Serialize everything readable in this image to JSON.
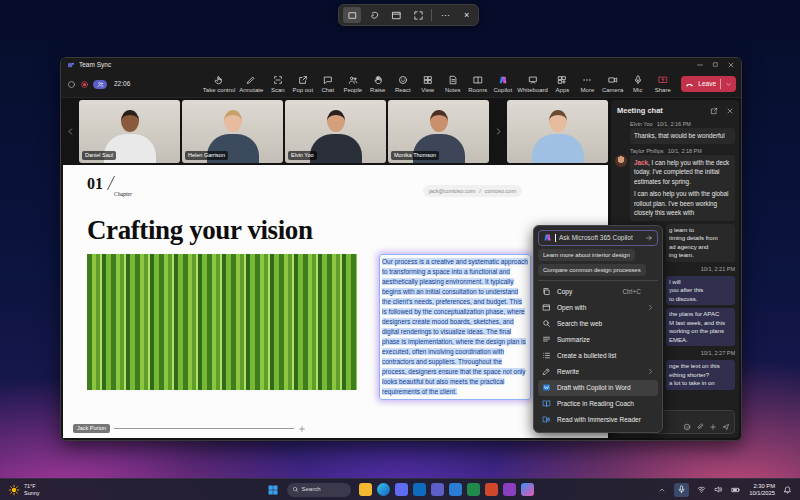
{
  "snip_toolbar": {
    "modes": [
      {
        "kind": "rectangle",
        "selected": true
      },
      {
        "kind": "freeform",
        "selected": false
      },
      {
        "kind": "window",
        "selected": false
      },
      {
        "kind": "fullscreen",
        "selected": false
      }
    ],
    "more": "···",
    "close": "×"
  },
  "window": {
    "title": "Team Sync",
    "timer": "22:06"
  },
  "toolbar": {
    "items": [
      {
        "label": "Take control",
        "kind": "control",
        "active": false
      },
      {
        "label": "Annotate",
        "kind": "annotate",
        "active": false
      },
      {
        "label": "Scan",
        "kind": "scan",
        "active": false
      },
      {
        "label": "Pop out",
        "kind": "popout",
        "active": false
      },
      {
        "label": "Chat",
        "kind": "chat",
        "active": false
      },
      {
        "label": "People",
        "kind": "people",
        "active": false
      },
      {
        "label": "Raise",
        "kind": "raise",
        "active": false
      },
      {
        "label": "React",
        "kind": "react",
        "active": false
      },
      {
        "label": "View",
        "kind": "view",
        "active": false
      },
      {
        "label": "Notes",
        "kind": "notes",
        "active": false
      },
      {
        "label": "Rooms",
        "kind": "rooms",
        "active": false
      },
      {
        "label": "Copilot",
        "kind": "copilot",
        "active": false
      },
      {
        "label": "Whiteboard",
        "kind": "whiteboard",
        "active": false
      },
      {
        "label": "Apps",
        "kind": "apps",
        "active": false
      },
      {
        "label": "More",
        "kind": "more",
        "active": false
      },
      {
        "label": "Camera",
        "kind": "camera",
        "active": false
      },
      {
        "label": "Mic",
        "kind": "mic",
        "active": false
      },
      {
        "label": "Share",
        "kind": "share",
        "active": true
      }
    ],
    "leave": "Leave"
  },
  "participants": [
    {
      "kind": "named",
      "name": "Daniel Saul"
    },
    {
      "kind": "named",
      "name": "Helen Garrison"
    },
    {
      "kind": "named",
      "name": "Elvin Yoo"
    },
    {
      "kind": "named",
      "name": "Monika Thomson"
    },
    {
      "kind": "unnamed"
    }
  ],
  "slide": {
    "number": "01",
    "section": "Chapter",
    "email": "jack@contoso.com",
    "separator": "/",
    "site": "contoso.com",
    "title": "Crafting your vision",
    "body": "Our process is a creative and systematic approach to transforming a space into a functional and aesthetically pleasing environment. It typically begins with an initial consultation to understand the client's needs, preferences, and budget. This is followed by the conceptualization phase, where designers create mood boards, sketches, and digital renderings to visualize ideas. The final phase is implementation, where the design plan is executed, often involving coordination with contractors and suppliers. Throughout the process, designers ensure that the space not only looks beautiful but also meets the practical requirements of the client.",
    "body_selected": true,
    "presenter": "Jack Purton"
  },
  "context_menu": {
    "prompt_placeholder": "Ask Microsoft 365 Copilot",
    "suggestions": [
      "Learn more about interior design",
      "Compare common design processes"
    ],
    "items": [
      {
        "label": "Copy",
        "kind": "copy",
        "shortcut": "Ctrl+C",
        "submenu": false,
        "highlighted": false
      },
      {
        "label": "Open with",
        "kind": "open",
        "submenu": true,
        "highlighted": false
      },
      {
        "label": "Search the web",
        "kind": "search",
        "submenu": false,
        "highlighted": false
      },
      {
        "label": "Summarize",
        "kind": "summarize",
        "submenu": false,
        "highlighted": false
      },
      {
        "label": "Create a bulleted list",
        "kind": "list",
        "submenu": false,
        "highlighted": false
      },
      {
        "label": "Rewrite",
        "kind": "rewrite",
        "submenu": true,
        "highlighted": false
      },
      {
        "label": "Draft with Copilot in Word",
        "kind": "word",
        "submenu": false,
        "highlighted": true
      },
      {
        "label": "Practice in Reading Coach",
        "kind": "reading",
        "submenu": false,
        "highlighted": false
      },
      {
        "label": "Read with Immersive Reader",
        "kind": "immersive",
        "submenu": false,
        "highlighted": false
      }
    ]
  },
  "chat": {
    "title": "Meeting chat",
    "messages": [
      {
        "kind": "received",
        "author": "Elvin Yoo",
        "time": "10/1, 2:16 PM",
        "avatar": false,
        "paragraphs": [
          {
            "text": "Thanks, that would be wonderful"
          }
        ]
      },
      {
        "kind": "received",
        "author": "Taylor Phillips",
        "time": "10/1, 2:18 PM",
        "avatar": true,
        "paragraphs": [
          {
            "mention": "Jack",
            "text": ", I can help you with the deck today. I've completed the initial estimates for spring."
          },
          {
            "text": "I can also help you with the global rollout plan. I've been working closely this week with"
          }
        ]
      },
      {
        "kind": "clipped",
        "lines": [
          "g team to",
          "timing details from",
          "ad agency and",
          "ing team."
        ]
      },
      {
        "kind": "timestamp",
        "time": "10/1, 2:21 PM"
      },
      {
        "kind": "sent_clipped",
        "lines": [
          "I will",
          "you after this",
          "to discuss."
        ]
      },
      {
        "kind": "sent_clipped",
        "lines": [
          "the plans for APAC",
          "M last week, and this",
          "working on the plans",
          "EMEA."
        ]
      },
      {
        "kind": "timestamp",
        "time": "10/1, 2:27 PM"
      },
      {
        "kind": "sent_clipped",
        "lines": [
          "nge the text on this",
          "ething shorter?",
          "a lot to take in on"
        ]
      }
    ]
  },
  "taskbar": {
    "temperature": "71°F",
    "weather": "Sunny",
    "search": "Search",
    "time": "2:30 PM",
    "date": "10/1/2025"
  }
}
